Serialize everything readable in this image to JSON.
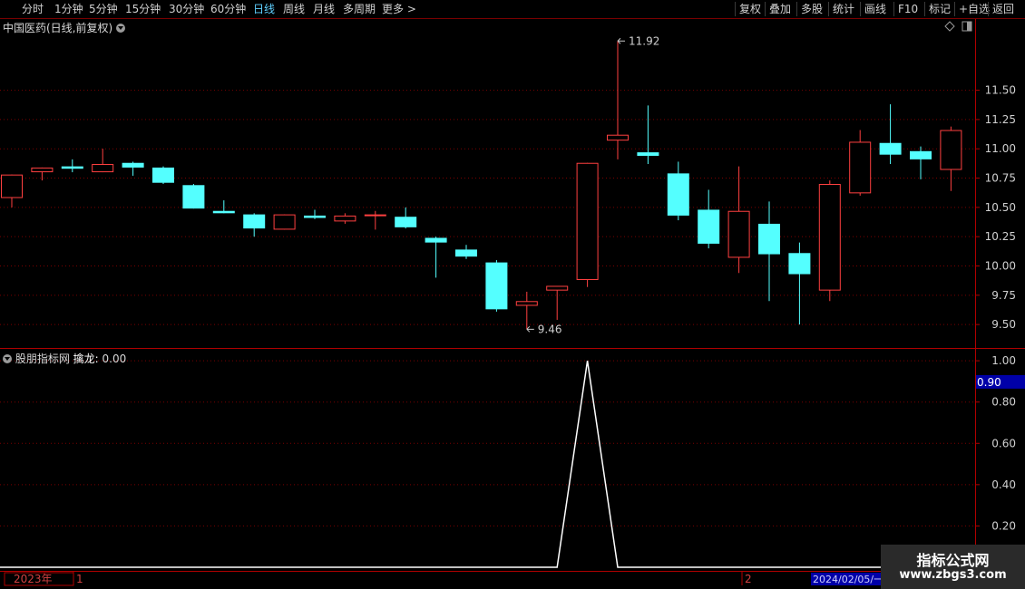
{
  "toolbar": {
    "left": [
      "分时",
      "1分钟",
      "5分钟",
      "15分钟",
      "30分钟",
      "60分钟",
      "日线",
      "周线",
      "月线",
      "多周期",
      "更多 >"
    ],
    "active_index": 6,
    "right": [
      "复权",
      "叠加",
      "多股",
      "统计",
      "画线",
      "F10",
      "标记",
      "+自选",
      "返回"
    ]
  },
  "main_panel": {
    "title": "中国医药(日线,前复权)",
    "high_label": "11.92",
    "low_label": "9.46",
    "y_ticks": [
      "11.50",
      "11.25",
      "11.00",
      "10.75",
      "10.50",
      "10.25",
      "10.00",
      "9.75",
      "9.50"
    ],
    "y_range": [
      9.3,
      12.1
    ],
    "candles": [
      {
        "o": 10.58,
        "h": 10.78,
        "l": 10.5,
        "c": 10.78
      },
      {
        "o": 10.8,
        "h": 10.84,
        "l": 10.73,
        "c": 10.84
      },
      {
        "o": 10.85,
        "h": 10.91,
        "l": 10.8,
        "c": 10.83
      },
      {
        "o": 10.8,
        "h": 11.0,
        "l": 10.8,
        "c": 10.87
      },
      {
        "o": 10.88,
        "h": 10.89,
        "l": 10.77,
        "c": 10.84
      },
      {
        "o": 10.84,
        "h": 10.85,
        "l": 10.7,
        "c": 10.71
      },
      {
        "o": 10.69,
        "h": 10.7,
        "l": 10.49,
        "c": 10.49
      },
      {
        "o": 10.47,
        "h": 10.56,
        "l": 10.45,
        "c": 10.45
      },
      {
        "o": 10.44,
        "h": 10.45,
        "l": 10.25,
        "c": 10.32
      },
      {
        "o": 10.31,
        "h": 10.44,
        "l": 10.31,
        "c": 10.44
      },
      {
        "o": 10.43,
        "h": 10.48,
        "l": 10.4,
        "c": 10.41
      },
      {
        "o": 10.38,
        "h": 10.45,
        "l": 10.36,
        "c": 10.43
      },
      {
        "o": 10.43,
        "h": 10.47,
        "l": 10.31,
        "c": 10.44
      },
      {
        "o": 10.42,
        "h": 10.5,
        "l": 10.32,
        "c": 10.33
      },
      {
        "o": 10.24,
        "h": 10.25,
        "l": 9.9,
        "c": 10.2
      },
      {
        "o": 10.14,
        "h": 10.18,
        "l": 10.06,
        "c": 10.08
      },
      {
        "o": 10.03,
        "h": 10.05,
        "l": 9.61,
        "c": 9.63
      },
      {
        "o": 9.66,
        "h": 9.78,
        "l": 9.46,
        "c": 9.7
      },
      {
        "o": 9.79,
        "h": 9.83,
        "l": 9.54,
        "c": 9.83
      },
      {
        "o": 9.88,
        "h": 10.88,
        "l": 9.82,
        "c": 10.88
      },
      {
        "o": 11.07,
        "h": 11.92,
        "l": 10.91,
        "c": 11.12
      },
      {
        "o": 10.97,
        "h": 11.37,
        "l": 10.87,
        "c": 10.94
      },
      {
        "o": 10.79,
        "h": 10.89,
        "l": 10.39,
        "c": 10.43
      },
      {
        "o": 10.48,
        "h": 10.65,
        "l": 10.15,
        "c": 10.19
      },
      {
        "o": 10.07,
        "h": 10.85,
        "l": 9.94,
        "c": 10.47
      },
      {
        "o": 10.36,
        "h": 10.55,
        "l": 9.7,
        "c": 10.1
      },
      {
        "o": 10.11,
        "h": 10.2,
        "l": 9.5,
        "c": 9.93
      },
      {
        "o": 9.79,
        "h": 10.73,
        "l": 9.7,
        "c": 10.7
      },
      {
        "o": 10.62,
        "h": 11.16,
        "l": 10.6,
        "c": 11.06
      },
      {
        "o": 11.05,
        "h": 11.38,
        "l": 10.87,
        "c": 10.95
      },
      {
        "o": 10.98,
        "h": 11.02,
        "l": 10.74,
        "c": 10.91
      },
      {
        "o": 10.82,
        "h": 11.19,
        "l": 10.64,
        "c": 11.16
      }
    ]
  },
  "indicator_panel": {
    "title_source": "股朋指标网",
    "title_name": "擒龙:",
    "title_value": "0.00",
    "y_ticks": [
      "1.00",
      "0.80",
      "0.60",
      "0.40",
      "0.20"
    ],
    "current_value": "0.90",
    "y_range": [
      0,
      1.04
    ],
    "series_values": [
      0,
      0,
      0,
      0,
      0,
      0,
      0,
      0,
      0,
      0,
      0,
      0,
      0,
      0,
      0,
      0,
      0,
      0,
      0,
      1,
      0,
      0,
      0,
      0,
      0,
      0,
      0,
      0,
      0,
      0,
      0,
      0
    ]
  },
  "time_axis": {
    "year_label": "2023年",
    "labels": [
      "1",
      "2"
    ],
    "cursor_date": "2024/02/05/一"
  },
  "watermark": {
    "line1": "指标公式网",
    "line2": "www.zbgs3.com"
  },
  "colors": {
    "up": "#ff4040",
    "down": "#54ffff",
    "axis": "#b00000",
    "grid": "#7a0000",
    "indicator_line": "#ffffff",
    "label_highlight": "#0000a8"
  }
}
